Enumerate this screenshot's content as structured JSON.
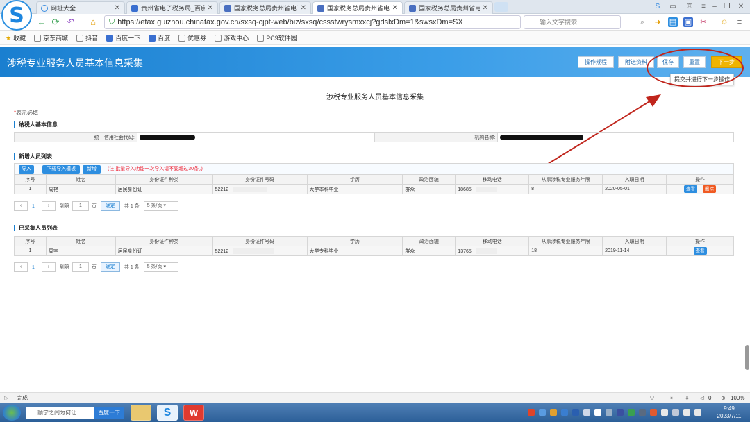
{
  "browser": {
    "logo_letter": "S",
    "tabs": [
      {
        "title": "网址大全",
        "color": "#3a8de0"
      },
      {
        "title": "贵州省电子税务局_百度",
        "color": "#3a8de0"
      },
      {
        "title": "国家税务总局贵州省电子",
        "color": "#4a6fc0"
      },
      {
        "title": "国家税务总局贵州省电子",
        "color": "#4a6fc0"
      },
      {
        "title": "国家税务总局贵州省电子",
        "color": "#4a6fc0"
      }
    ],
    "tab_close": "✕",
    "url": "https://etax.guizhou.chinatax.gov.cn/sxsq-cjpt-web/biz/sxsq/csssfwrysmxxcj?gdslxDm=1&swsxDm=SX",
    "search_placeholder": "输入文字搜索",
    "bookmarks": [
      "收藏",
      "京东商城",
      "抖音",
      "百度一下",
      "百度",
      "优惠券",
      "游戏中心",
      "PC9软件园"
    ]
  },
  "page": {
    "header_title": "涉税专业服务人员基本信息采集",
    "header_buttons": {
      "op_guide": "操作规程",
      "attachments": "附送资料",
      "save": "保存",
      "reset": "重置",
      "next": "下一步"
    },
    "tooltip": "提交并进行下一步操作",
    "form_title": "涉税专业服务人员基本信息采集",
    "required_star": "*",
    "required_text": "表示必填",
    "taxpayer_section": "纳税人基本信息",
    "taxpayer_fields": {
      "credit_code_label": "统一信用社会代码:",
      "org_name_label": "机构名称:"
    },
    "new_section": "新增人员列表",
    "toolbar": {
      "import": "导入",
      "download_template": "下载导入模板",
      "add": "新增",
      "note": "(注:批量导入功能一次导入请不要超过30条。)"
    },
    "columns": [
      "序号",
      "姓名",
      "身份证件种类",
      "身份证件号码",
      "学历",
      "政治面貌",
      "移动电话",
      "从事涉税专业服务年限",
      "入职日期",
      "操作"
    ],
    "new_rows": [
      {
        "no": "1",
        "name": "周艳",
        "id_type": "居民身份证",
        "id_no": "52212",
        "edu": "大学本科毕业",
        "political": "群众",
        "phone": "18685",
        "years": "8",
        "date": "2020-05-01"
      }
    ],
    "collected_section": "已采集人员列表",
    "collected_rows": [
      {
        "no": "1",
        "name": "周宇",
        "id_type": "居民身份证",
        "id_no": "52212",
        "edu": "大学专科毕业",
        "political": "群众",
        "phone": "13765",
        "years": "18",
        "date": "2019-11-14"
      }
    ],
    "actions": {
      "view": "查看",
      "delete": "删除"
    },
    "pager": {
      "prev": "‹",
      "next": "›",
      "current": "1",
      "goto": "到第",
      "page_unit": "页",
      "ok": "确定",
      "total": "共 1 条",
      "size": "5 条/页"
    }
  },
  "status": {
    "text": "完成",
    "zoom": "100%",
    "counter": "0"
  },
  "taskbar": {
    "search_text": "颢宁之间为何让...",
    "search_button": "百度一下",
    "time": "9:49",
    "date": "2023/7/11"
  }
}
